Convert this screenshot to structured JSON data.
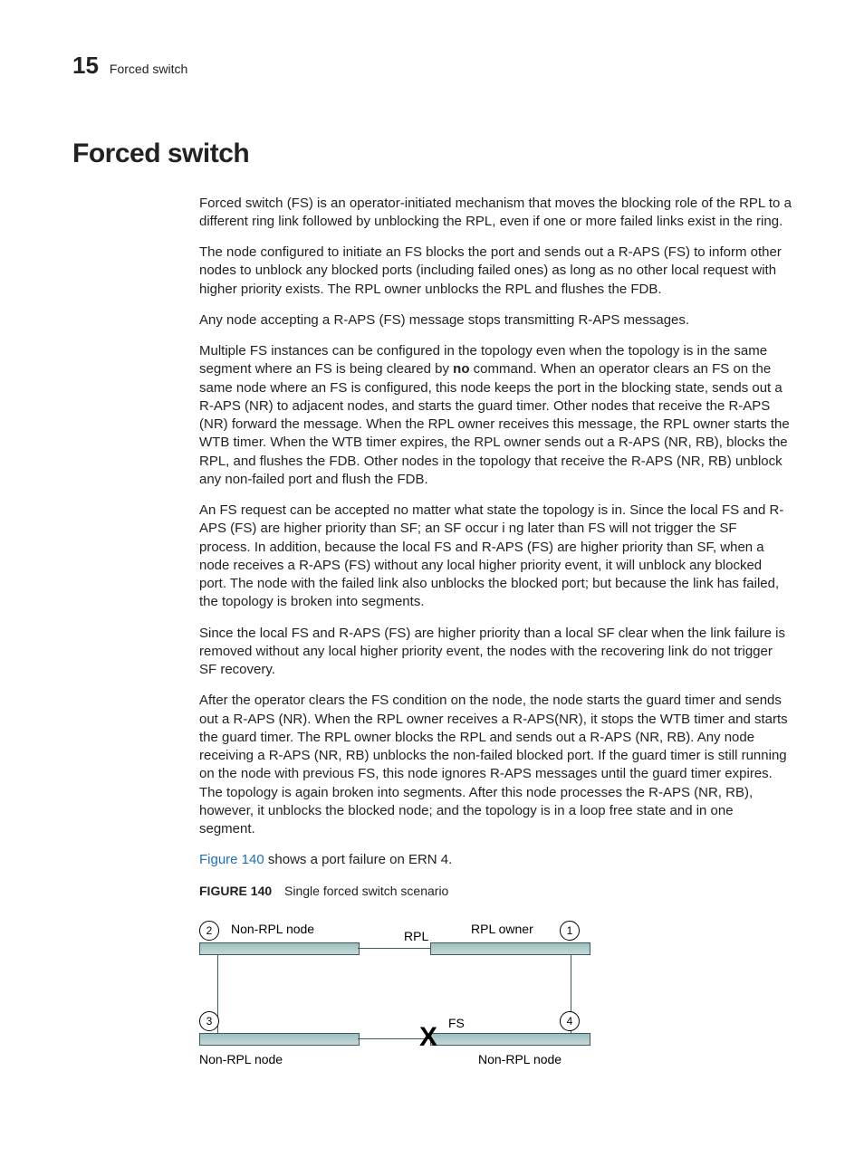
{
  "header": {
    "chapter_number": "15",
    "chapter_label": "Forced switch"
  },
  "title": "Forced switch",
  "paragraphs": {
    "p1": "Forced switch (FS) is an operator-initiated mechanism that moves the blocking role of the RPL to a different ring link followed by unblocking the RPL, even if one or more failed links exist in the ring.",
    "p2": "The node configured to initiate an FS blocks the port and sends out a R-APS (FS) to inform other nodes to unblock any blocked ports (including failed ones) as long as no other local request with higher priority exists. The RPL owner unblocks the RPL and flushes the FDB.",
    "p3": "Any node accepting a R-APS (FS) message stops transmitting R-APS messages.",
    "p4a": "Multiple FS instances can be configured in the topology even when the topology is in the same segment where an FS is being cleared by ",
    "p4b": "no",
    "p4c": " command. When an operator clears an FS on the same node where an FS is configured, this node keeps the port in the blocking state, sends out a R-APS (NR) to adjacent nodes, and starts the guard timer. Other nodes that receive the R-APS (NR) forward the message. When the RPL owner receives this message, the RPL owner starts the WTB timer. When the WTB timer expires, the RPL owner sends out a R-APS (NR, RB), blocks the RPL, and flushes the FDB. Other nodes in the topology that receive the R-APS (NR, RB) unblock any non-failed port and flush the FDB.",
    "p5": "An FS request can be accepted no matter what state the topology is in. Since the local FS and R-APS (FS) are higher priority than SF; an SF occur i ng later than FS will not trigger the SF process. In addition, because the local FS and R-APS (FS) are higher priority than SF, when a node receives a R-APS (FS) without any local higher priority event, it will unblock any blocked port. The node with the failed link also unblocks the blocked port; but because the link has failed, the topology is broken into segments.",
    "p6": "Since the local FS and R-APS (FS) are higher priority than a local SF clear when the link failure is removed without any local higher priority event, the nodes with the recovering link do not trigger SF recovery.",
    "p7": "After the operator clears the FS condition on the node, the node starts the guard timer and sends out a R-APS (NR). When the RPL owner receives a R-APS(NR), it stops the WTB timer and starts the guard timer. The RPL owner blocks the RPL and sends out a R-APS (NR, RB). Any node receiving a R-APS (NR, RB) unblocks the non-failed blocked port. If the guard timer is still running on the node with previous FS, this node ignores R-APS messages until the guard timer expires. The topology is again broken into segments. After this node processes the R-APS (NR, RB), however, it unblocks the blocked node; and the topology is in a loop free state and in one segment.",
    "p8a": "Figure 140",
    "p8b": " shows a port failure on ERN 4."
  },
  "figure": {
    "label": "FIGURE 140",
    "caption": "Single forced switch scenario"
  },
  "diagram": {
    "nodes": {
      "n1": "1",
      "n2": "2",
      "n3": "3",
      "n4": "4"
    },
    "labels": {
      "non_rpl_node_tl": "Non-RPL node",
      "rpl_owner": "RPL owner",
      "rpl": "RPL",
      "non_rpl_node_bl": "Non-RPL node",
      "non_rpl_node_br": "Non-RPL node",
      "fs": "FS",
      "x": "X"
    }
  }
}
